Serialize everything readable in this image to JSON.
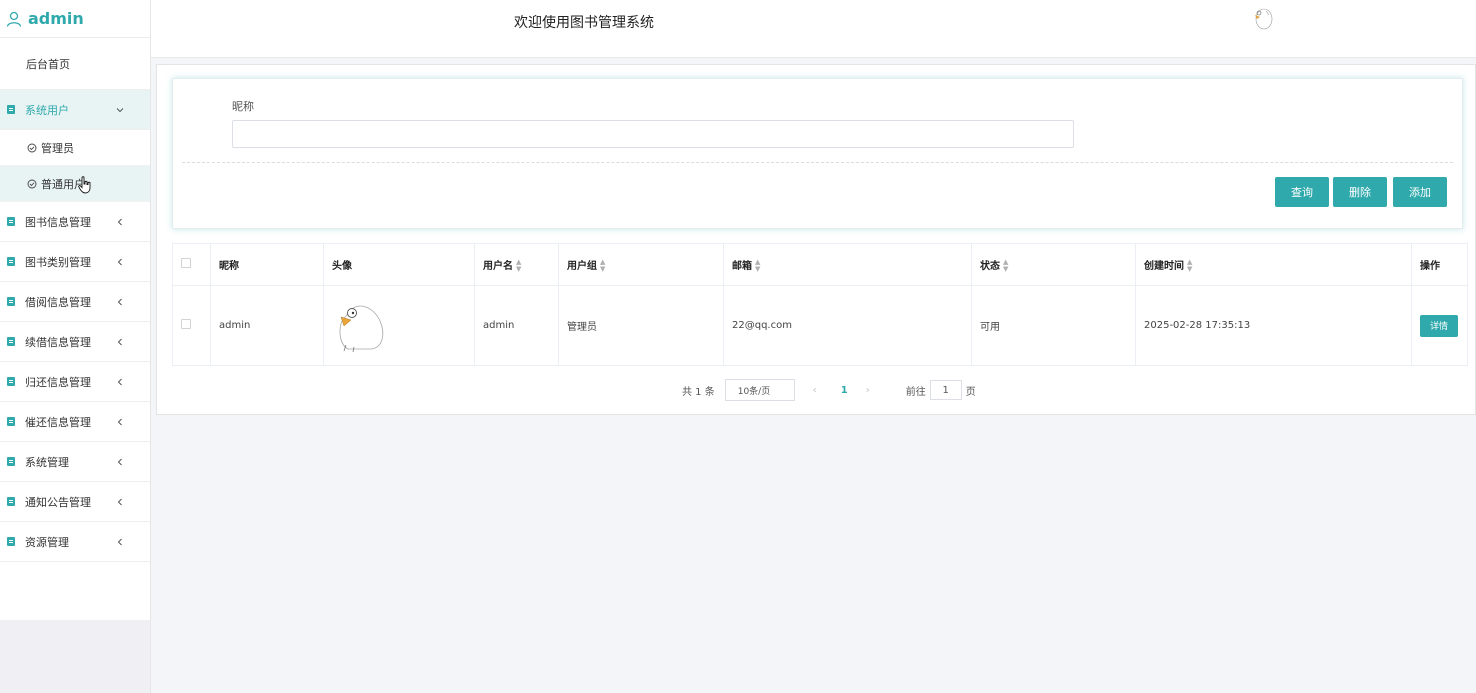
{
  "brand": {
    "name": "admin",
    "icon": "user-icon"
  },
  "header": {
    "title": "欢迎使用图书管理系统",
    "avatar_icon": "duck-avatar-icon"
  },
  "sidebar": {
    "home": "后台首页",
    "system_users": {
      "label": "系统用户",
      "children": [
        "管理员",
        "普通用户"
      ]
    },
    "items": [
      "图书信息管理",
      "图书类别管理",
      "借阅信息管理",
      "续借信息管理",
      "归还信息管理",
      "催还信息管理",
      "系统管理",
      "通知公告管理",
      "资源管理"
    ]
  },
  "search": {
    "label": "昵称",
    "value": "",
    "placeholder": "",
    "buttons": {
      "query": "查询",
      "delete": "删除",
      "add": "添加"
    }
  },
  "table": {
    "columns": [
      "昵称",
      "头像",
      "用户名",
      "用户组",
      "邮箱",
      "状态",
      "创建时间",
      "操作"
    ],
    "rows": [
      {
        "nickname": "admin",
        "username": "admin",
        "group": "管理员",
        "email": "22@qq.com",
        "status": "可用",
        "created": "2025-02-28 17:35:13",
        "action": "详情"
      }
    ]
  },
  "pagination": {
    "total": "共 1 条",
    "page_size": "10条/页",
    "prev": "‹",
    "current": "1",
    "next": "›",
    "goto_label": "前往",
    "goto_value": "1",
    "page_suffix": "页"
  },
  "colors": {
    "accent": "#2fa9ab",
    "active_bg": "#e8f4f4"
  }
}
